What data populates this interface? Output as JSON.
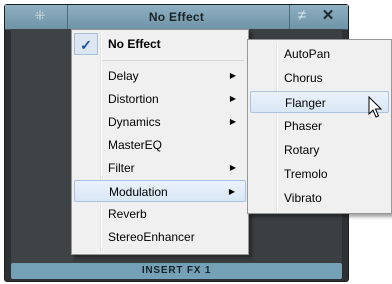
{
  "window": {
    "title": "No Effect",
    "status": "INSERT  FX 1",
    "move_glyph": "⁜",
    "bypass_glyph": "≠",
    "close_glyph": "✕"
  },
  "main_menu": {
    "items": [
      {
        "label": "No Effect",
        "checked": true,
        "bold": true
      },
      {
        "label": "Delay",
        "submenu": true
      },
      {
        "label": "Distortion",
        "submenu": true
      },
      {
        "label": "Dynamics",
        "submenu": true
      },
      {
        "label": "MasterEQ"
      },
      {
        "label": "Filter",
        "submenu": true
      },
      {
        "label": "Modulation",
        "submenu": true,
        "highlighted": true
      },
      {
        "label": "Reverb"
      },
      {
        "label": "StereoEnhancer"
      }
    ],
    "check_glyph": "✓",
    "arrow_glyph": "▶"
  },
  "sub_menu": {
    "items": [
      {
        "label": "AutoPan"
      },
      {
        "label": "Chorus"
      },
      {
        "label": "Flanger",
        "highlighted": true
      },
      {
        "label": "Phaser"
      },
      {
        "label": "Rotary"
      },
      {
        "label": "Tremolo"
      },
      {
        "label": "Vibrato"
      }
    ]
  },
  "colors": {
    "title_bar": "#7fa2b5",
    "status_bar": "#75a1b6",
    "menu_bg": "#f0f0f0",
    "highlight": "#dbe8f6"
  }
}
